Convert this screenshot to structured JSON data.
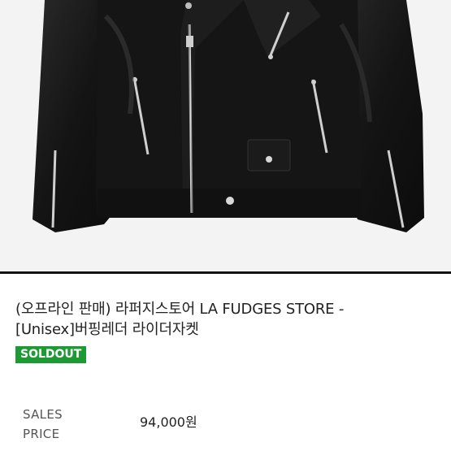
{
  "product": {
    "title_line1": "(오프라인 판매) 라퍼지스토어 LA FUDGES STORE -",
    "title_line2": "[Unisex]버핑레더 라이더자켓",
    "badge": "SOLDOUT",
    "badge_color": "#1e9a34",
    "price_label_line1": "SALES",
    "price_label_line2": "PRICE",
    "price": "94,000원"
  },
  "image": {
    "subject": "black leather rider jacket photo",
    "colors": {
      "background": "#f3f3f3",
      "leather": "#161616",
      "hardware": "#c9c9c9"
    }
  }
}
